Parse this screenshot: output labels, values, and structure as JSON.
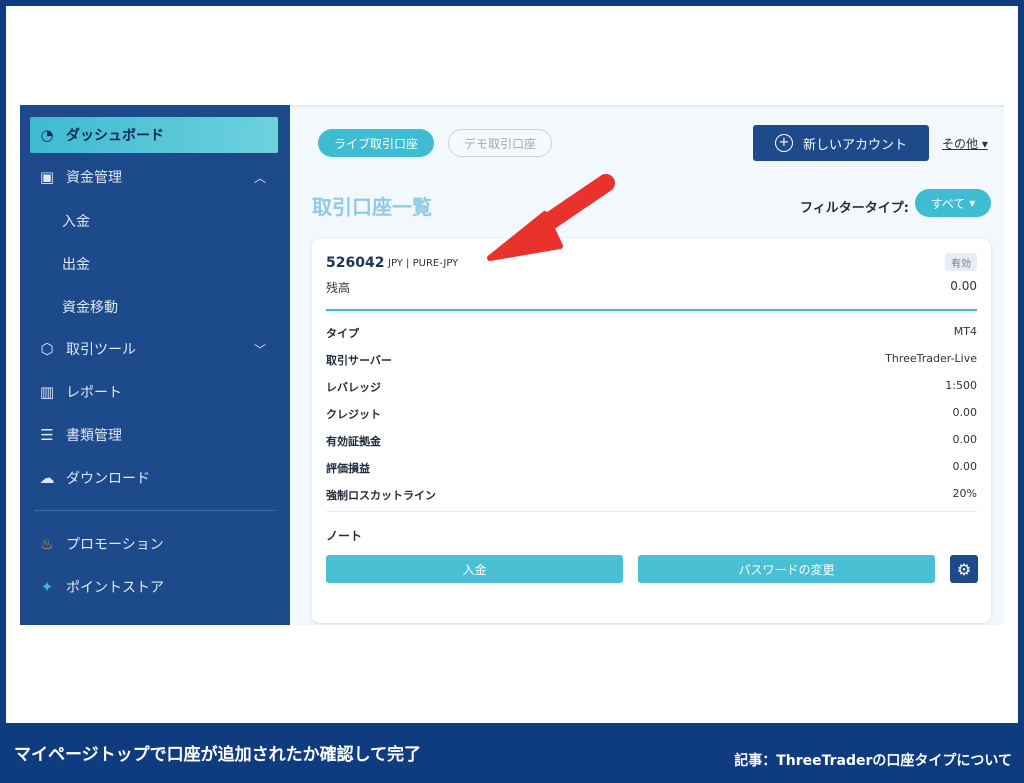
{
  "sidebar": {
    "items": [
      {
        "label": "ダッシュボード",
        "icon": "gauge-icon"
      },
      {
        "label": "資金管理",
        "icon": "calendar-icon"
      },
      {
        "label": "取引ツール",
        "icon": "cube-icon"
      },
      {
        "label": "レポート",
        "icon": "chart-icon"
      },
      {
        "label": "書類管理",
        "icon": "document-icon"
      },
      {
        "label": "ダウンロード",
        "icon": "cloud-download-icon"
      },
      {
        "label": "プロモーション",
        "icon": "fire-icon"
      },
      {
        "label": "ポイントストア",
        "icon": "gift-icon"
      }
    ],
    "fund_sub": [
      "入金",
      "出金",
      "資金移動"
    ]
  },
  "tabs": {
    "live": "ライブ取引口座",
    "demo": "デモ取引口座"
  },
  "new_account": "新しいアカウント",
  "other": "その他",
  "page_title": "取引口座一覧",
  "filter": {
    "label": "フィルタータイプ:",
    "value": "すべて"
  },
  "account": {
    "number": "526042",
    "meta": "JPY | PURE-JPY",
    "status": "有効",
    "balance_label": "残高",
    "balance": "0.00",
    "rows": [
      {
        "k": "タイプ",
        "v": "MT4"
      },
      {
        "k": "取引サーバー",
        "v": "ThreeTrader-Live"
      },
      {
        "k": "レバレッジ",
        "v": "1:500"
      },
      {
        "k": "クレジット",
        "v": "0.00"
      },
      {
        "k": "有効証拠金",
        "v": "0.00"
      },
      {
        "k": "評価損益",
        "v": "0.00"
      },
      {
        "k": "強制ロスカットライン",
        "v": "20%"
      }
    ],
    "note": "ノート",
    "deposit_btn": "入金",
    "password_btn": "パスワードの変更"
  },
  "caption": {
    "left": "マイページトップで口座が追加されたか確認して完了",
    "right": "記事：ThreeTraderの口座タイプについて"
  },
  "colors": {
    "navy": "#1d4a8a",
    "teal": "#3fbcd2",
    "arrow": "#e8322b"
  }
}
